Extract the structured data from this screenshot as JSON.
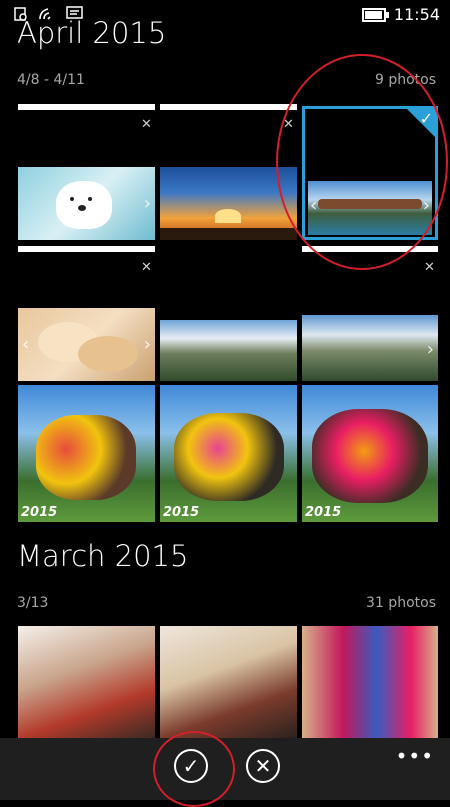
{
  "status": {
    "time": "11:54"
  },
  "april": {
    "title": "April 2015",
    "range": "4/8 - 4/11",
    "count": "9 photos"
  },
  "march": {
    "title": "March 2015",
    "range": "3/13",
    "count": "31 photos"
  },
  "stamps": [
    "2015",
    "2015",
    "2015"
  ],
  "appbar": {
    "confirm_glyph": "✓",
    "cancel_glyph": "✕",
    "more_label": "•••"
  },
  "icons": {
    "status": [
      "sim-icon",
      "wifi-icon",
      "message-icon",
      "battery-icon"
    ],
    "tile": [
      "dismiss-x-icon",
      "chevron-left-icon",
      "chevron-right-icon",
      "checkmark-icon"
    ],
    "appbar": [
      "confirm-check-icon",
      "cancel-x-icon",
      "more-icon"
    ]
  },
  "colors": {
    "accent": "#2a9fd8",
    "annotation": "#d21f2a"
  }
}
